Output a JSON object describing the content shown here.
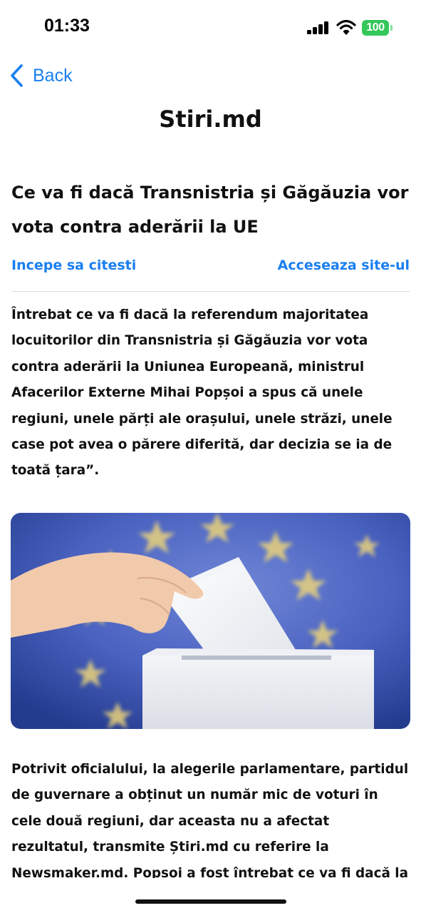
{
  "status_bar": {
    "time": "01:33",
    "battery": "100",
    "battery_color": "#34c759"
  },
  "nav": {
    "back_label": "Back",
    "back_icon": "chevron-left-icon",
    "accent": "#1a7ff0"
  },
  "site_title": "Stiri.md",
  "article": {
    "title": "Ce va fi dacă Transnistria și Găgăuzia vor vota contra aderării la UE",
    "start_reading_label": "Incepe sa citesti",
    "visit_site_label": "Acceseaza site-ul",
    "paragraph_1": "Întrebat ce va fi dacă la referendum majoritatea locuitorilor din Transnistria și Găgăuzia vor vota contra aderării la Uniunea Europeană, ministrul Afacerilor Externe Mihai Popșoi a spus că unele regiuni, unele părți ale orașului, unele străzi, unele case pot avea o părere diferită, dar decizia se ia de toată țara”.",
    "image": "eu-flag-ballot-box-photo",
    "paragraph_2": "Potrivit oficialului, la alegerile parlamentare, partidul de guvernare a obținut un număr mic de voturi în cele două regiuni, dar aceasta nu a afectat rezultatul, transmite Știri.md cu referire la Newsmaker.md. Popșoi a fost întrebat ce va fi dacă la"
  }
}
